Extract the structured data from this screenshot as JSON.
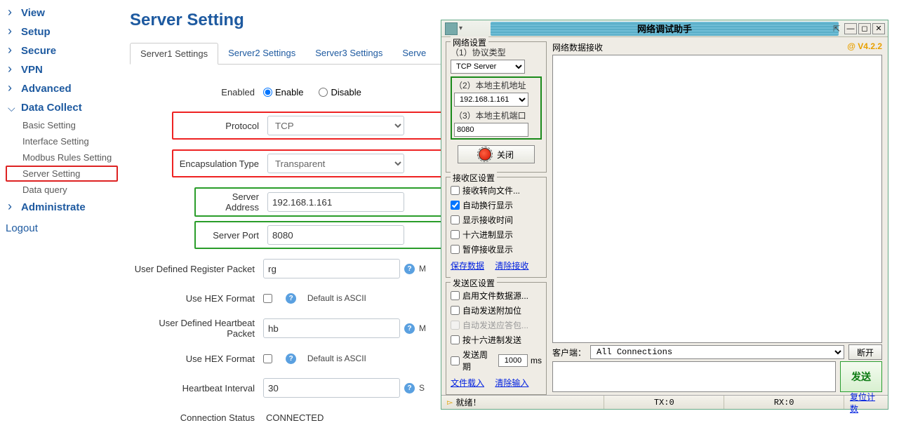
{
  "sidebar": {
    "items": [
      {
        "label": "View"
      },
      {
        "label": "Setup"
      },
      {
        "label": "Secure"
      },
      {
        "label": "VPN"
      },
      {
        "label": "Advanced"
      },
      {
        "label": "Data Collect",
        "expanded": true,
        "children": [
          {
            "label": "Basic Setting"
          },
          {
            "label": "Interface Setting"
          },
          {
            "label": "Modbus Rules Setting"
          },
          {
            "label": "Server Setting",
            "active": true
          },
          {
            "label": "Data query"
          }
        ]
      },
      {
        "label": "Administrate"
      }
    ],
    "logout": "Logout"
  },
  "page": {
    "title": "Server Setting",
    "tabs": [
      "Server1 Settings",
      "Server2 Settings",
      "Server3 Settings",
      "Serve"
    ],
    "active_tab": 0,
    "form": {
      "enabled_label": "Enabled",
      "enable": "Enable",
      "disable": "Disable",
      "enabled_value": "enable",
      "protocol_label": "Protocol",
      "protocol_value": "TCP",
      "encap_label": "Encapsulation Type",
      "encap_value": "Transparent",
      "server_addr_label": "Server Address",
      "server_addr_value": "192.168.1.161",
      "server_port_label": "Server Port",
      "server_port_value": "8080",
      "reg_packet_label": "User Defined Register Packet",
      "reg_packet_value": "rg",
      "hex1_label": "Use HEX Format",
      "hex_help": "Default is ASCII",
      "hb_packet_label": "User Defined Heartbeat Packet",
      "hb_packet_value": "hb",
      "hex2_label": "Use HEX Format",
      "hb_interval_label": "Heartbeat Interval",
      "hb_interval_value": "30",
      "conn_status_label": "Connection Status",
      "conn_status_value": "CONNECTED"
    }
  },
  "netassist": {
    "title": "网络调试助手",
    "version": "@ V4.2.2",
    "net_setting_title": "网络设置",
    "proto_label": "（1）协议类型",
    "proto_value": "TCP Server",
    "host_label": "（2）本地主机地址",
    "host_value": "192.168.1.161",
    "port_label": "（3）本地主机端口",
    "port_value": "8080",
    "close_btn": "关闭",
    "rx_setting_title": "接收区设置",
    "rx_opts": [
      {
        "label": "接收转向文件...",
        "checked": false
      },
      {
        "label": "自动换行显示",
        "checked": true
      },
      {
        "label": "显示接收时间",
        "checked": false
      },
      {
        "label": "十六进制显示",
        "checked": false
      },
      {
        "label": "暂停接收显示",
        "checked": false
      }
    ],
    "rx_links": {
      "save": "保存数据",
      "clear": "清除接收"
    },
    "tx_setting_title": "发送区设置",
    "tx_opts": [
      {
        "label": "启用文件数据源...",
        "checked": false
      },
      {
        "label": "自动发送附加位",
        "checked": false
      },
      {
        "label": "自动发送应答包...",
        "checked": false,
        "disabled": true
      },
      {
        "label": "按十六进制发送",
        "checked": false
      }
    ],
    "cycle_label": "发送周期",
    "cycle_value": "1000",
    "cycle_unit": "ms",
    "tx_links": {
      "load": "文件载入",
      "clear": "清除输入"
    },
    "rx_head": "网络数据接收",
    "client_label": "客户端：",
    "client_value": "All Connections",
    "disconnect_btn": "断开",
    "send_btn": "发送",
    "status_ready": "就绪！",
    "tx_count": "TX:0",
    "rx_count": "RX:0",
    "reset_btn": "复位计数"
  }
}
